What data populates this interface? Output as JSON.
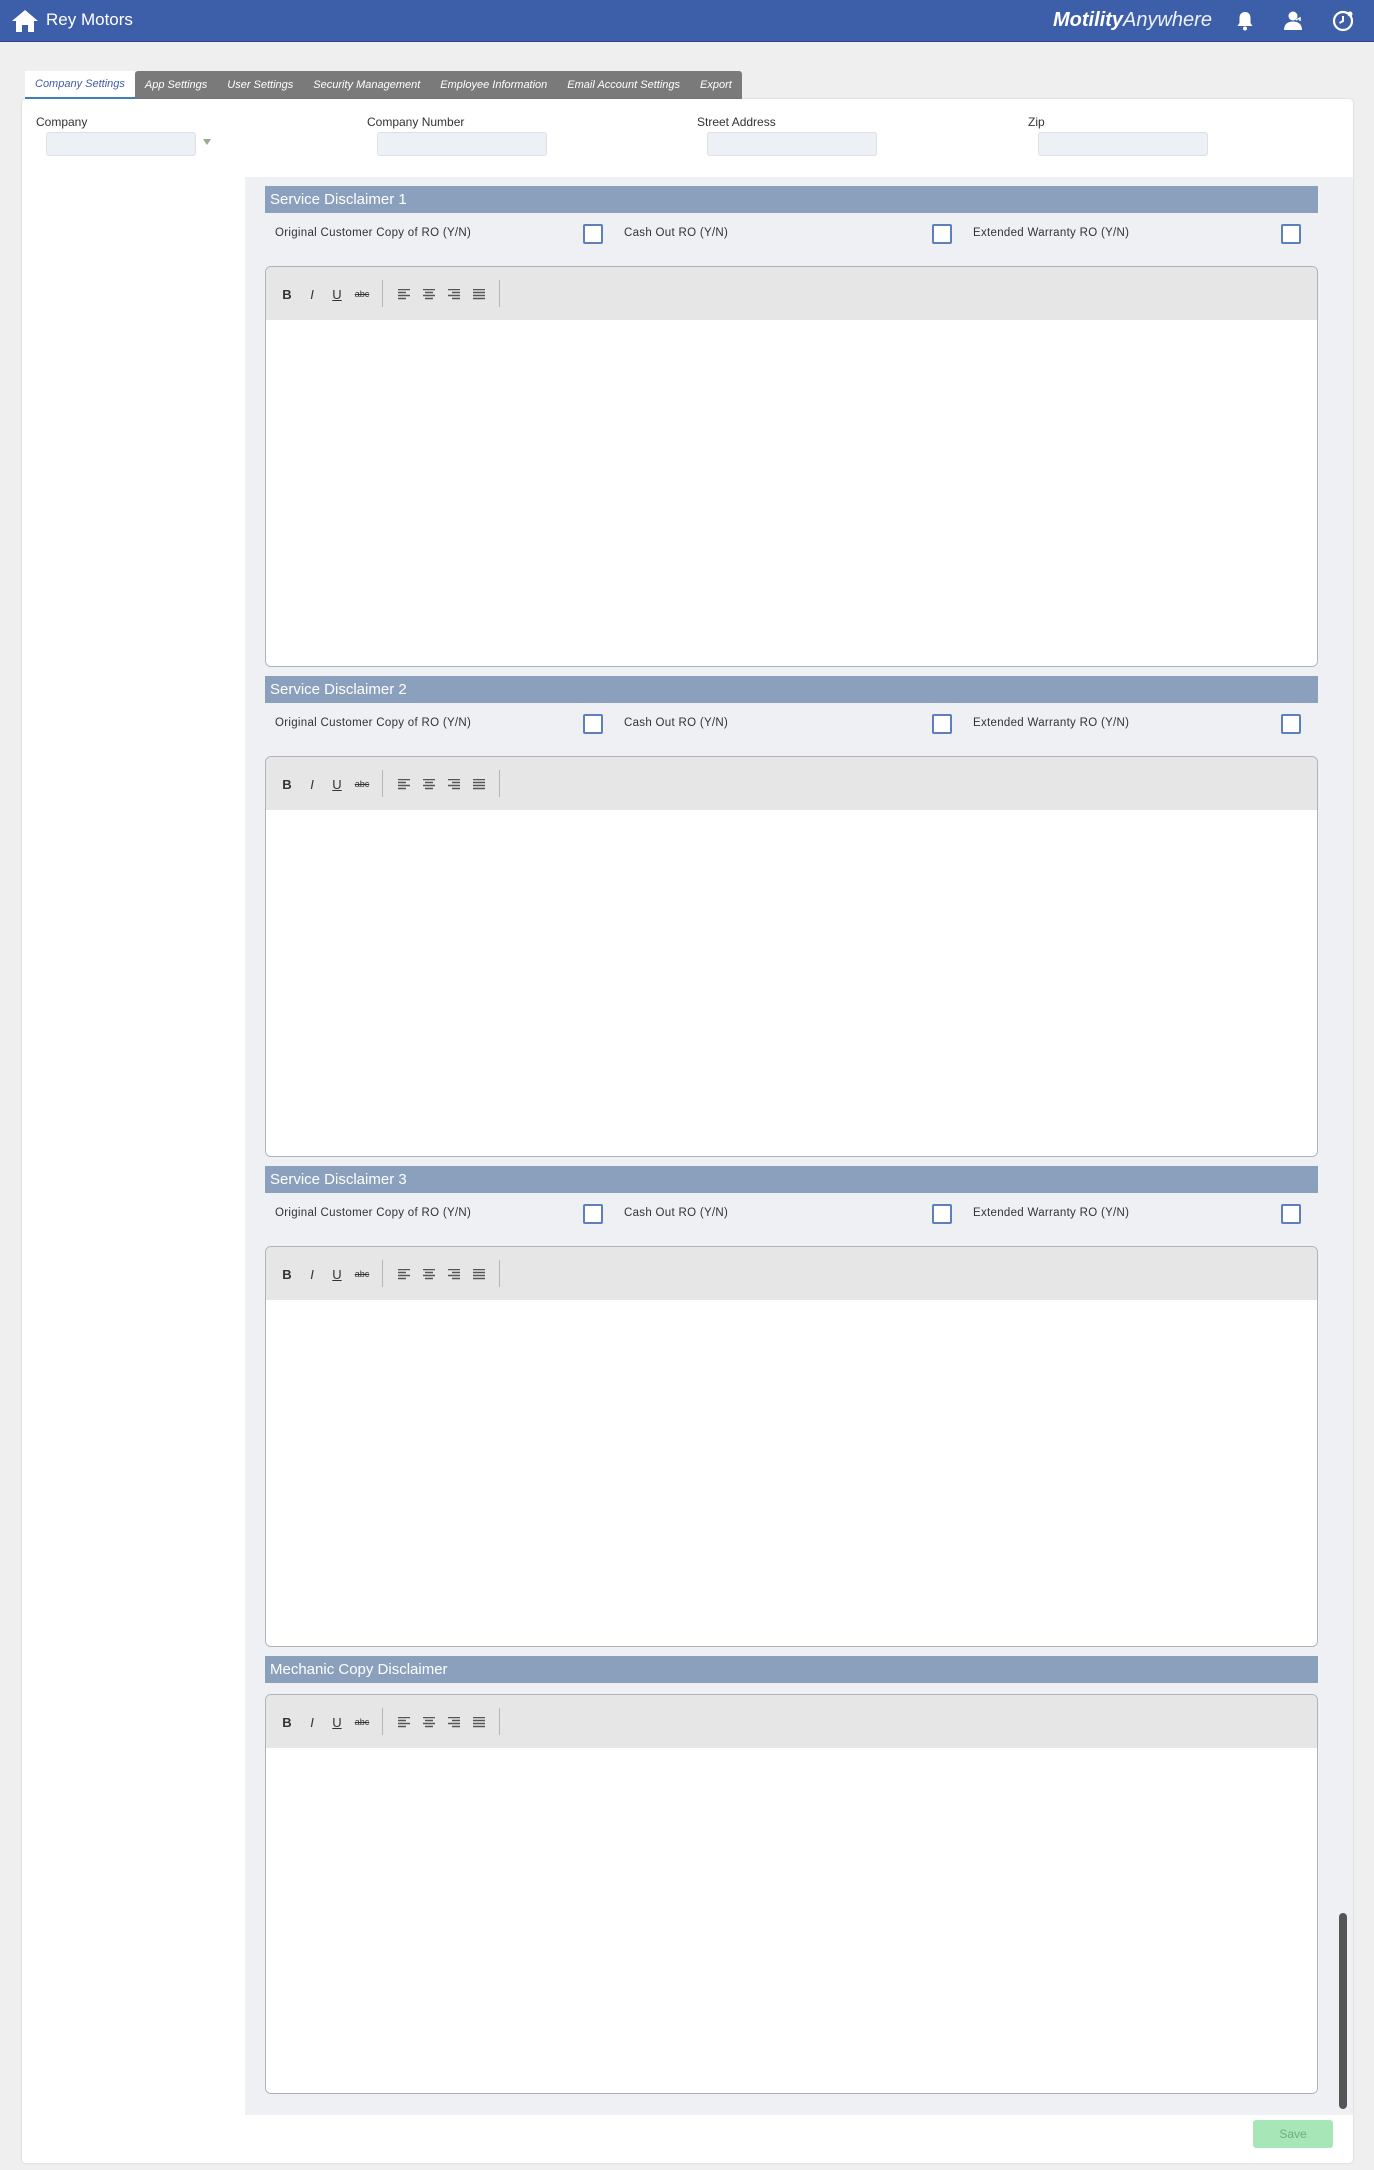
{
  "header": {
    "app_name": "Rey Motors",
    "brand_bold": "Motility",
    "brand_light": "Anywhere",
    "icons": [
      "home-icon",
      "bell-icon",
      "user-icon",
      "clock-icon"
    ],
    "color": "#3d5ea8"
  },
  "tabs": [
    {
      "label": "Company Settings",
      "active": true
    },
    {
      "label": "App Settings",
      "active": false
    },
    {
      "label": "User Settings",
      "active": false
    },
    {
      "label": "Security Management",
      "active": false
    },
    {
      "label": "Employee Information",
      "active": false
    },
    {
      "label": "Email Account Settings",
      "active": false
    },
    {
      "label": "Export",
      "active": false
    }
  ],
  "fields": {
    "company": {
      "label": "Company",
      "value": ""
    },
    "company_number": {
      "label": "Company Number",
      "value": ""
    },
    "street_address": {
      "label": "Street Address",
      "value": ""
    },
    "zip": {
      "label": "Zip",
      "value": ""
    }
  },
  "checkbox_labels": {
    "original": "Original Customer Copy of RO (Y/N)",
    "cash_out": "Cash Out RO (Y/N)",
    "extended": "Extended Warranty RO (Y/N)"
  },
  "sections": [
    {
      "title": "Service Disclaimer 1",
      "original": false,
      "cash_out": false,
      "extended": false,
      "content": ""
    },
    {
      "title": "Service Disclaimer 2",
      "original": false,
      "cash_out": false,
      "extended": false,
      "content": ""
    },
    {
      "title": "Service Disclaimer 3",
      "original": false,
      "cash_out": false,
      "extended": false,
      "content": ""
    },
    {
      "title": "Mechanic Copy Disclaimer",
      "content": ""
    }
  ],
  "toolbar": {
    "bold": "B",
    "italic": "I",
    "underline": "U",
    "strike": "abc",
    "align_icons": [
      "align-left-icon",
      "align-center-icon",
      "align-right-icon",
      "align-justify-icon"
    ]
  },
  "actions": {
    "save_label": "Save",
    "save_color": "#a7e6b6"
  }
}
